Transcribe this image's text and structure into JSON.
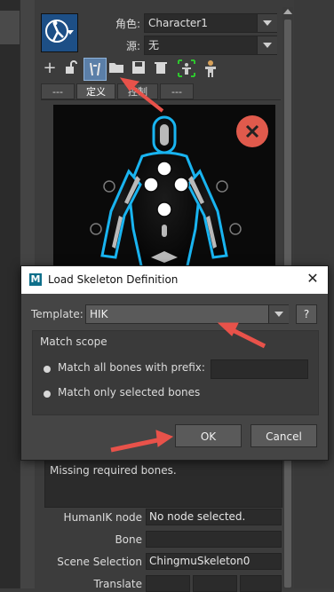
{
  "header": {
    "character_label": "角色:",
    "character_value": "Character1",
    "source_label": "源:",
    "source_value": "无"
  },
  "tabs": [
    "---",
    "定义",
    "控制",
    "---"
  ],
  "message": "Missing required bones.",
  "properties": [
    {
      "label": "HumanIK node",
      "value": "No node selected."
    },
    {
      "label": "Bone",
      "value": ""
    },
    {
      "label": "Scene Selection",
      "value": "ChingmuSkeleton0"
    },
    {
      "label": "Translate",
      "value": ""
    }
  ],
  "dialog": {
    "title": "Load Skeleton Definition",
    "template_label": "Template:",
    "template_value": "HIK",
    "help_label": "?",
    "group_title": "Match scope",
    "option_prefix": "Match all bones with prefix:",
    "option_selected": "Match only selected bones",
    "ok_label": "OK",
    "cancel_label": "Cancel"
  },
  "colors": {
    "annotation_arrow": "#e8524a",
    "close_badge": "#e05a4c",
    "figure_glow": "#19b4f0"
  }
}
